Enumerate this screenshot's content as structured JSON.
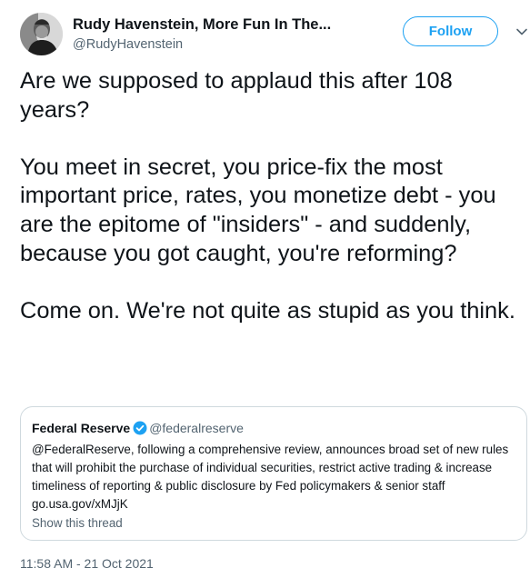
{
  "author": {
    "display_name": "Rudy Havenstein, More Fun In The...",
    "handle": "@RudyHavenstein"
  },
  "follow_button": {
    "label": "Follow"
  },
  "tweet": {
    "paragraphs": [
      "Are we supposed to applaud this after 108 years?",
      "You meet in secret, you price-fix the most important price, rates, you monetize debt - you are the epitome of \"insiders\" - and suddenly, because you got caught, you're reforming?",
      "Come on. We're not quite as stupid as you think."
    ],
    "timestamp": "11:58 AM - 21 Oct 2021"
  },
  "quoted_tweet": {
    "author_name": "Federal Reserve",
    "handle": "@federalreserve",
    "body": "@FederalReserve, following a comprehensive review, announces broad set of new rules that will prohibit the purchase of individual securities, restrict active trading & increase timeliness of reporting & public disclosure by Fed policymakers & senior staff",
    "link": "go.usa.gov/xMJjK",
    "show_thread": "Show this thread"
  },
  "colors": {
    "accent": "#1da1f2",
    "text": "#0f1419",
    "secondary_text": "#536471",
    "border": "#cfd9de"
  }
}
